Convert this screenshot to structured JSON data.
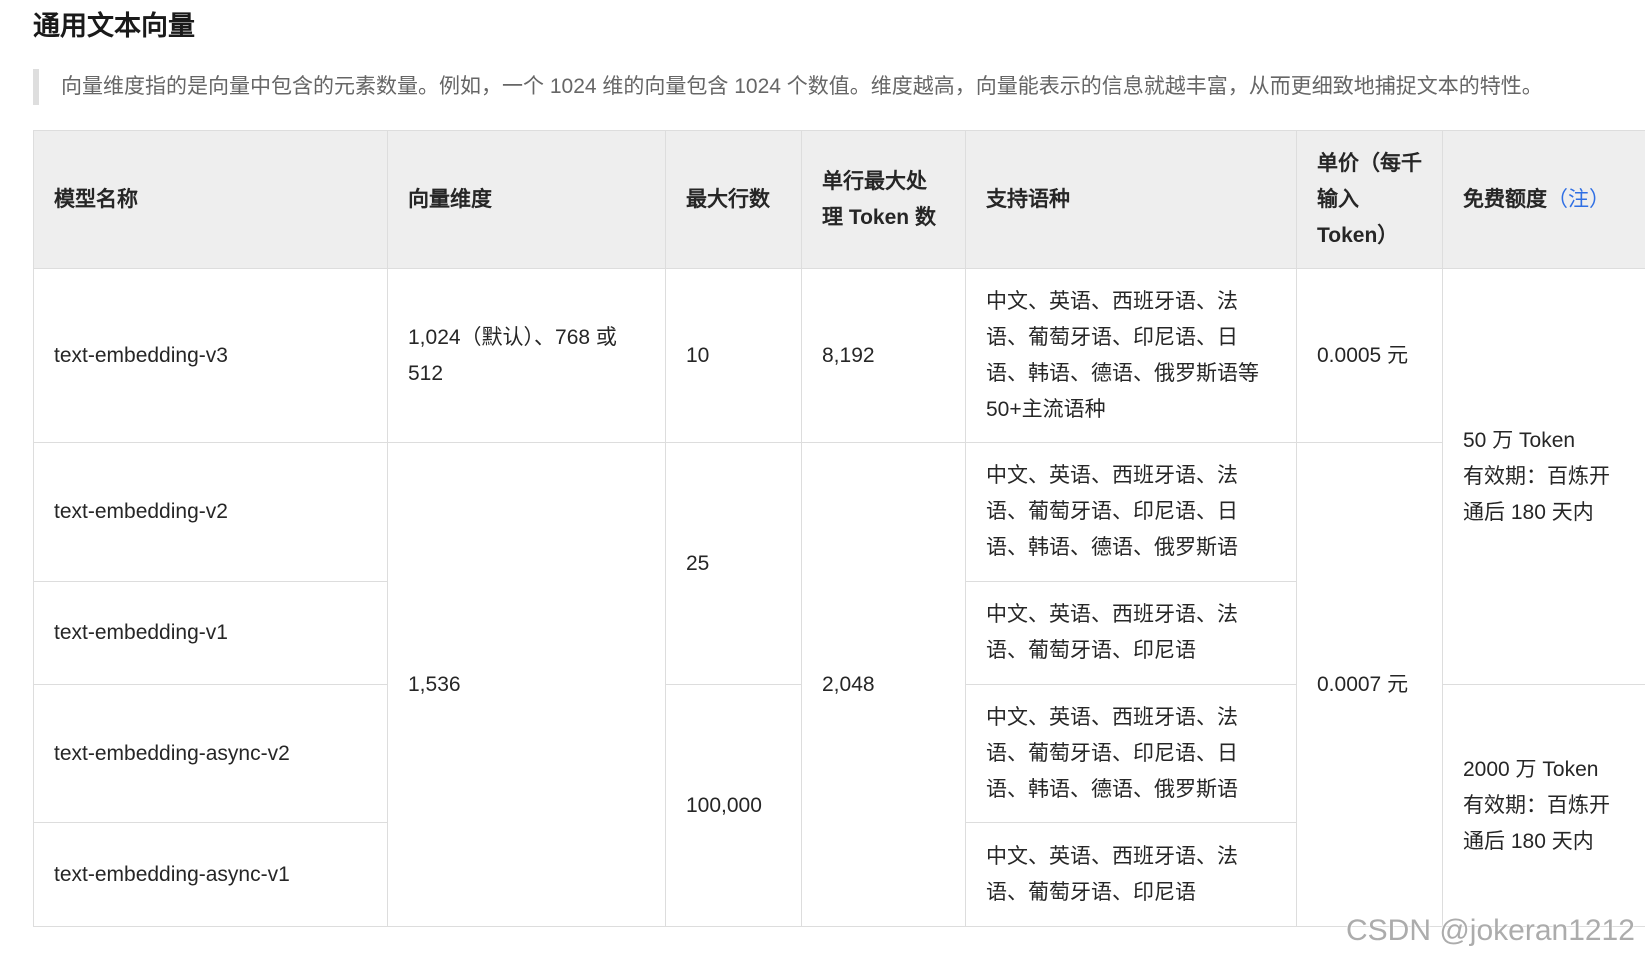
{
  "title": "通用文本向量",
  "note": "向量维度指的是向量中包含的元素数量。例如，一个 1024 维的向量包含 1024 个数值。维度越高，向量能表示的信息就越丰富，从而更细致地捕捉文本的特性。",
  "table": {
    "headers": {
      "model": "模型名称",
      "dimension": "向量维度",
      "max_rows": "最大行数",
      "max_tokens": "单行最大处理 Token 数",
      "languages": "支持语种",
      "price": "单价（每千输入Token）",
      "free_quota": "免费额度",
      "free_quota_note": "（注）"
    },
    "rows": [
      {
        "model": "text-embedding-v3",
        "dimension": "1,024（默认）、768 或 512",
        "max_rows": "10",
        "max_tokens": "8,192",
        "languages": "中文、英语、西班牙语、法语、葡萄牙语、印尼语、日语、韩语、德语、俄罗斯语等50+主流语种",
        "price": "0.0005 元",
        "free_quota": {
          "amount": "50 万 Token",
          "validity": "有效期：百炼开通后 180 天内"
        }
      },
      {
        "model": "text-embedding-v2",
        "dimension": "1,536",
        "max_rows": "25",
        "max_tokens": "2,048",
        "languages": "中文、英语、西班牙语、法语、葡萄牙语、印尼语、日语、韩语、德语、俄罗斯语",
        "price": "0.0007 元"
      },
      {
        "model": "text-embedding-v1",
        "languages": "中文、英语、西班牙语、法语、葡萄牙语、印尼语"
      },
      {
        "model": "text-embedding-async-v2",
        "max_rows": "100,000",
        "languages": "中文、英语、西班牙语、法语、葡萄牙语、印尼语、日语、韩语、德语、俄罗斯语",
        "free_quota": {
          "amount": "2000 万 Token",
          "validity": "有效期：百炼开通后 180 天内"
        }
      },
      {
        "model": "text-embedding-async-v1",
        "languages": "中文、英语、西班牙语、法语、葡萄牙语、印尼语"
      }
    ]
  },
  "watermark": "CSDN @jokeran1212"
}
